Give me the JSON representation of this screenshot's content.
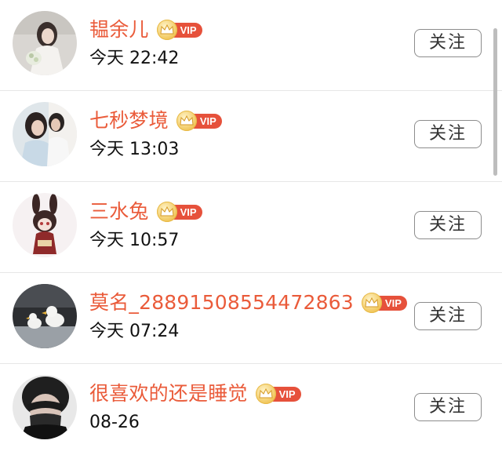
{
  "follow_label": "关注",
  "vip_label": "VIP",
  "colors": {
    "name": "#ea5b3a",
    "vip_tag": "#e6513b",
    "crown": "#f1c65a"
  },
  "users": [
    {
      "name": "韫余儿",
      "time": "今天 22:42",
      "avatar": "avatar-bride-photo"
    },
    {
      "name": "七秒梦境",
      "time": "今天 13:03",
      "avatar": "avatar-couple-photo"
    },
    {
      "name": "三水兔",
      "time": "今天 10:57",
      "avatar": "avatar-anime-bunny-girl"
    },
    {
      "name": "莫名_28891508554472863",
      "time": "今天 07:24",
      "avatar": "avatar-duck-figurines"
    },
    {
      "name": "很喜欢的还是睡觉",
      "time": "08-26",
      "avatar": "avatar-masked-person"
    }
  ]
}
